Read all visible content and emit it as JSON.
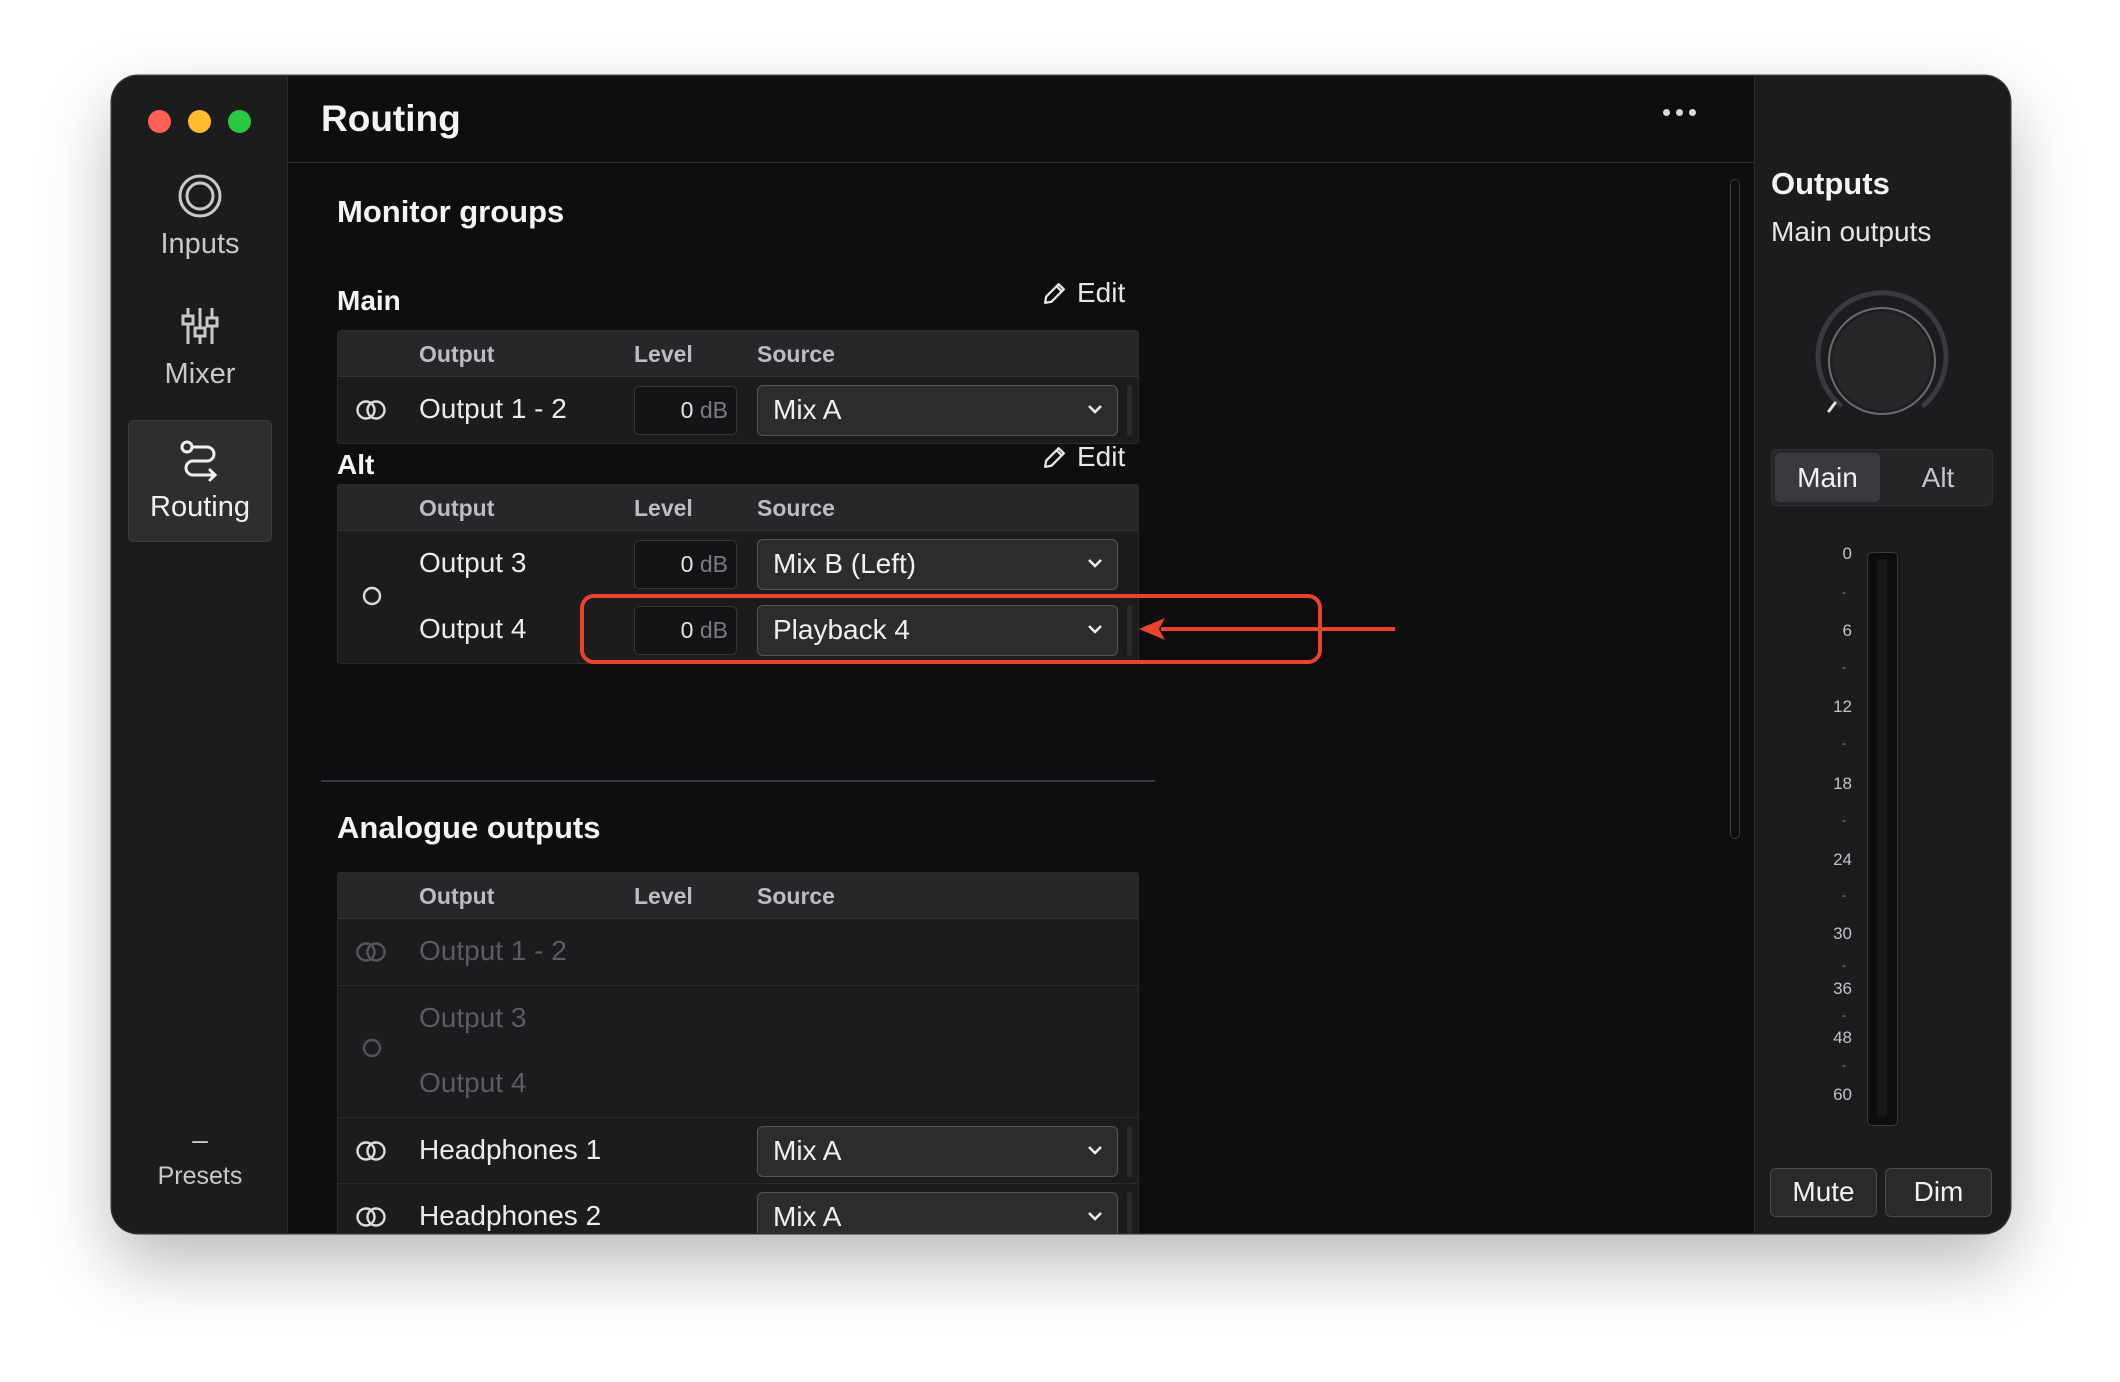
{
  "window": {
    "traffic_lights": [
      "close",
      "minimize",
      "zoom"
    ]
  },
  "sidebar": {
    "items": [
      {
        "label": "Inputs",
        "icon": "inputs-icon",
        "active": false
      },
      {
        "label": "Mixer",
        "icon": "mixer-icon",
        "active": false
      },
      {
        "label": "Routing",
        "icon": "routing-icon",
        "active": true
      }
    ],
    "presets": {
      "dash": "–",
      "label": "Presets"
    }
  },
  "header": {
    "title": "Routing",
    "more_icon": "more-icon"
  },
  "monitor_groups": {
    "title": "Monitor groups",
    "main": {
      "title": "Main",
      "edit_label": "Edit",
      "columns": [
        "Output",
        "Level",
        "Source"
      ],
      "rows": [
        {
          "output": "Output 1 - 2",
          "level": "0",
          "unit": "dB",
          "source": "Mix A",
          "icon": "stereo-link-icon"
        }
      ]
    },
    "alt": {
      "title": "Alt",
      "edit_label": "Edit",
      "columns": [
        "Output",
        "Level",
        "Source"
      ],
      "rows": [
        {
          "output": "Output 3",
          "level": "0",
          "unit": "dB",
          "source": "Mix B (Left)",
          "highlighted": true
        },
        {
          "output": "Output 4",
          "level": "0",
          "unit": "dB",
          "source": "Playback 4"
        }
      ],
      "icon": "mono-circle-icon"
    }
  },
  "analogue_outputs": {
    "title": "Analogue outputs",
    "columns": [
      "Output",
      "Level",
      "Source"
    ],
    "rows": [
      {
        "output": "Output 1 - 2",
        "disabled": true
      },
      {
        "output": "Output 3",
        "disabled": true
      },
      {
        "output": "Output 4",
        "disabled": true
      },
      {
        "output": "Headphones 1",
        "source": "Mix A"
      },
      {
        "output": "Headphones 2",
        "source": "Mix A"
      }
    ]
  },
  "outputs_panel": {
    "title": "Outputs",
    "subtitle": "Main outputs",
    "segment": {
      "main": "Main",
      "alt": "Alt",
      "selected": "Main"
    },
    "meter_scale": [
      "0",
      "6",
      "12",
      "18",
      "24",
      "30",
      "36",
      "48",
      "60"
    ],
    "mute_label": "Mute",
    "dim_label": "Dim"
  },
  "colors": {
    "highlight": "#e8432c",
    "background": "#0e0e10",
    "panel": "#1c1c1e"
  }
}
